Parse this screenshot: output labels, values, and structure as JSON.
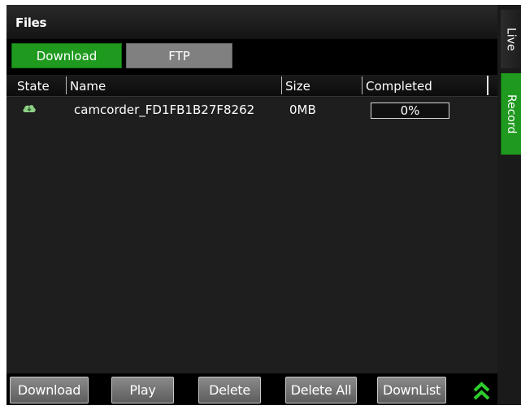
{
  "window": {
    "title": "Files"
  },
  "tabs": [
    {
      "label": "Download",
      "active": true
    },
    {
      "label": "FTP",
      "active": false
    }
  ],
  "table": {
    "columns": [
      "State",
      "Name",
      "Size",
      "Completed"
    ],
    "rows": [
      {
        "state_icon": "cloud-download-icon",
        "name": "camcorder_FD1FB1B27F8262",
        "size": "0MB",
        "completed": "0%",
        "progress": 0
      }
    ]
  },
  "buttons": {
    "download": "Download",
    "play": "Play",
    "delete": "Delete",
    "delete_all": "Delete All",
    "downlist": "DownList"
  },
  "side_tabs": {
    "live": "Live",
    "record": "Record"
  },
  "colors": {
    "accent_green": "#1f9a1f",
    "tab_inactive": "#808080",
    "background": "#1e1e1e"
  }
}
